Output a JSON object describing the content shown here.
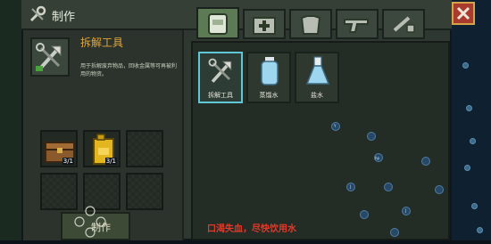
{
  "window": {
    "title": "制作"
  },
  "selected_item": {
    "name": "拆解工具",
    "description": "用于拆解废弃物品，回收金属等可再被利用的物资。"
  },
  "ingredients": [
    {
      "name": "treasure-chest",
      "count": "3/1"
    },
    {
      "name": "fuel-can",
      "count": "3/1"
    }
  ],
  "craft_button": {
    "label": "制作"
  },
  "tabs": [
    {
      "name": "backpack",
      "active": true
    },
    {
      "name": "medical-kit",
      "active": false
    },
    {
      "name": "clothing",
      "active": false
    },
    {
      "name": "weapon",
      "active": false
    },
    {
      "name": "tools",
      "active": false
    }
  ],
  "recipes": [
    {
      "label": "拆解工具",
      "icon": "wrench-axe-icon",
      "selected": true
    },
    {
      "label": "蒸馏水",
      "icon": "water-bottle-icon",
      "selected": false
    },
    {
      "label": "盐水",
      "icon": "flask-icon",
      "selected": false
    }
  ],
  "warning": "口渴失血，尽快饮用水",
  "map_nodes": [
    "Y",
    "hp",
    "J",
    "J"
  ],
  "colors": {
    "accent_gold": "#e4a53a",
    "warning_red": "#e23a2a",
    "selection_cyan": "#5fc7d6",
    "close_red": "#a93a2e"
  }
}
